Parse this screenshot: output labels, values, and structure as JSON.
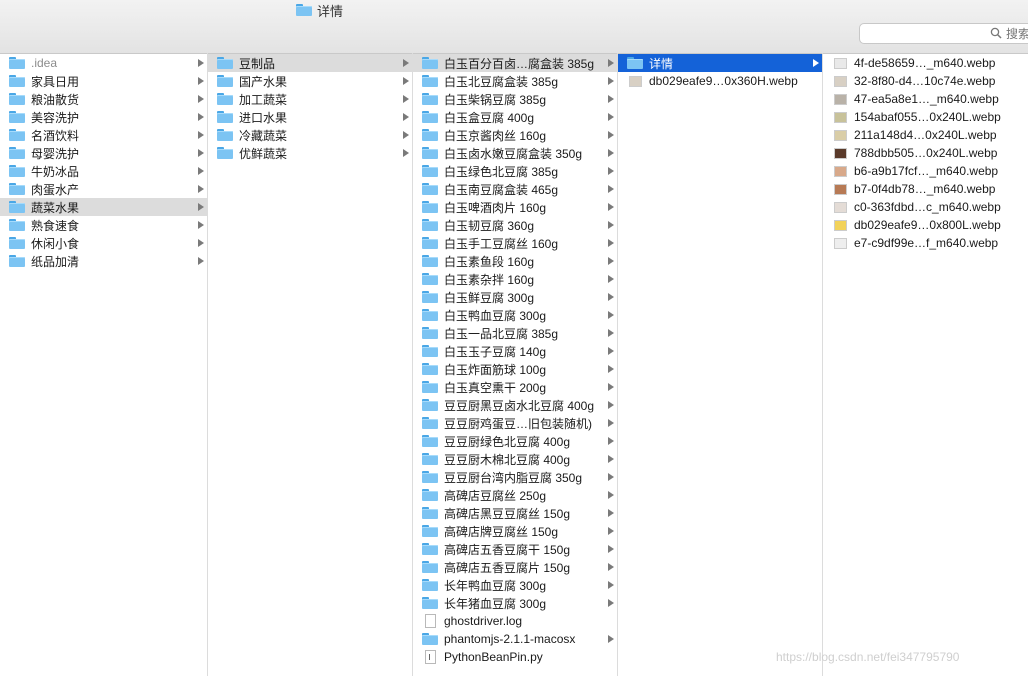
{
  "window": {
    "title": "详情"
  },
  "search": {
    "placeholder": "搜索"
  },
  "columns": [
    {
      "items": [
        {
          "label": ".idea",
          "dim": true
        },
        {
          "label": "家具日用"
        },
        {
          "label": "粮油散货"
        },
        {
          "label": "美容洗护"
        },
        {
          "label": "名酒饮料"
        },
        {
          "label": "母婴洗护"
        },
        {
          "label": "牛奶冰品"
        },
        {
          "label": "肉蛋水产"
        },
        {
          "label": "蔬菜水果",
          "selected": "gray"
        },
        {
          "label": "熟食速食"
        },
        {
          "label": "休闲小食"
        },
        {
          "label": "纸品加清"
        }
      ]
    },
    {
      "items": [
        {
          "label": "豆制品",
          "selected": "gray"
        },
        {
          "label": "国产水果"
        },
        {
          "label": "加工蔬菜"
        },
        {
          "label": "进口水果"
        },
        {
          "label": "冷藏蔬菜"
        },
        {
          "label": "优鲜蔬菜"
        }
      ]
    },
    {
      "items": [
        {
          "label": "白玉百分百卤…腐盒装 385g",
          "selected": "gray"
        },
        {
          "label": "白玉北豆腐盒装 385g"
        },
        {
          "label": "白玉柴锅豆腐 385g"
        },
        {
          "label": "白玉盒豆腐 400g"
        },
        {
          "label": "白玉京酱肉丝 160g"
        },
        {
          "label": "白玉卤水嫩豆腐盒装 350g"
        },
        {
          "label": "白玉绿色北豆腐 385g"
        },
        {
          "label": "白玉南豆腐盒装 465g"
        },
        {
          "label": "白玉啤酒肉片 160g"
        },
        {
          "label": "白玉韧豆腐 360g"
        },
        {
          "label": "白玉手工豆腐丝 160g"
        },
        {
          "label": "白玉素鱼段 160g"
        },
        {
          "label": "白玉素杂拌 160g"
        },
        {
          "label": "白玉鲜豆腐 300g"
        },
        {
          "label": "白玉鸭血豆腐 300g"
        },
        {
          "label": "白玉一品北豆腐 385g"
        },
        {
          "label": "白玉玉子豆腐 140g"
        },
        {
          "label": "白玉炸面筋球 100g"
        },
        {
          "label": "白玉真空熏干 200g"
        },
        {
          "label": "豆豆厨黑豆卤水北豆腐 400g"
        },
        {
          "label": "豆豆厨鸡蛋豆…旧包装随机)"
        },
        {
          "label": "豆豆厨绿色北豆腐 400g"
        },
        {
          "label": "豆豆厨木棉北豆腐 400g"
        },
        {
          "label": "豆豆厨台湾内脂豆腐 350g"
        },
        {
          "label": "高碑店豆腐丝 250g"
        },
        {
          "label": "高碑店黑豆豆腐丝 150g"
        },
        {
          "label": "高碑店牌豆腐丝 150g"
        },
        {
          "label": "高碑店五香豆腐干 150g"
        },
        {
          "label": "高碑店五香豆腐片 150g"
        },
        {
          "label": "长年鸭血豆腐 300g"
        },
        {
          "label": "长年猪血豆腐 300g"
        },
        {
          "label": "ghostdriver.log",
          "kind": "file"
        },
        {
          "label": "phantomjs-2.1.1-macosx"
        },
        {
          "label": "PythonBeanPin.py",
          "kind": "script"
        }
      ]
    },
    {
      "items": [
        {
          "label": "详情",
          "selected": "blue"
        },
        {
          "label": "db029eafe9…0x360H.webp",
          "kind": "image"
        }
      ]
    },
    {
      "items": [
        {
          "label": "4f-de58659…_m640.webp",
          "kind": "image"
        },
        {
          "label": "32-8f80-d4…10c74e.webp",
          "kind": "image"
        },
        {
          "label": "47-ea5a8e1…_m640.webp",
          "kind": "image"
        },
        {
          "label": "154abaf055…0x240L.webp",
          "kind": "image"
        },
        {
          "label": "211a148d4…0x240L.webp",
          "kind": "image"
        },
        {
          "label": "788dbb505…0x240L.webp",
          "kind": "image"
        },
        {
          "label": "b6-a9b17fcf…_m640.webp",
          "kind": "image"
        },
        {
          "label": "b7-0f4db78…_m640.webp",
          "kind": "image"
        },
        {
          "label": "c0-363fdbd…c_m640.webp",
          "kind": "image"
        },
        {
          "label": "db029eafe9…0x800L.webp",
          "kind": "image"
        },
        {
          "label": "e7-c9df99e…f_m640.webp",
          "kind": "image"
        }
      ]
    }
  ],
  "thumb_colors": [
    "#e9e9e9",
    "#d8d0c4",
    "#b9b2a8",
    "#c8c29a",
    "#d9cda7",
    "#5a3a2a",
    "#d8a98a",
    "#b77a55",
    "#e4dcd6",
    "#f2d25a",
    "#eeeeee"
  ],
  "watermark": "https://blog.csdn.net/fei347795790"
}
